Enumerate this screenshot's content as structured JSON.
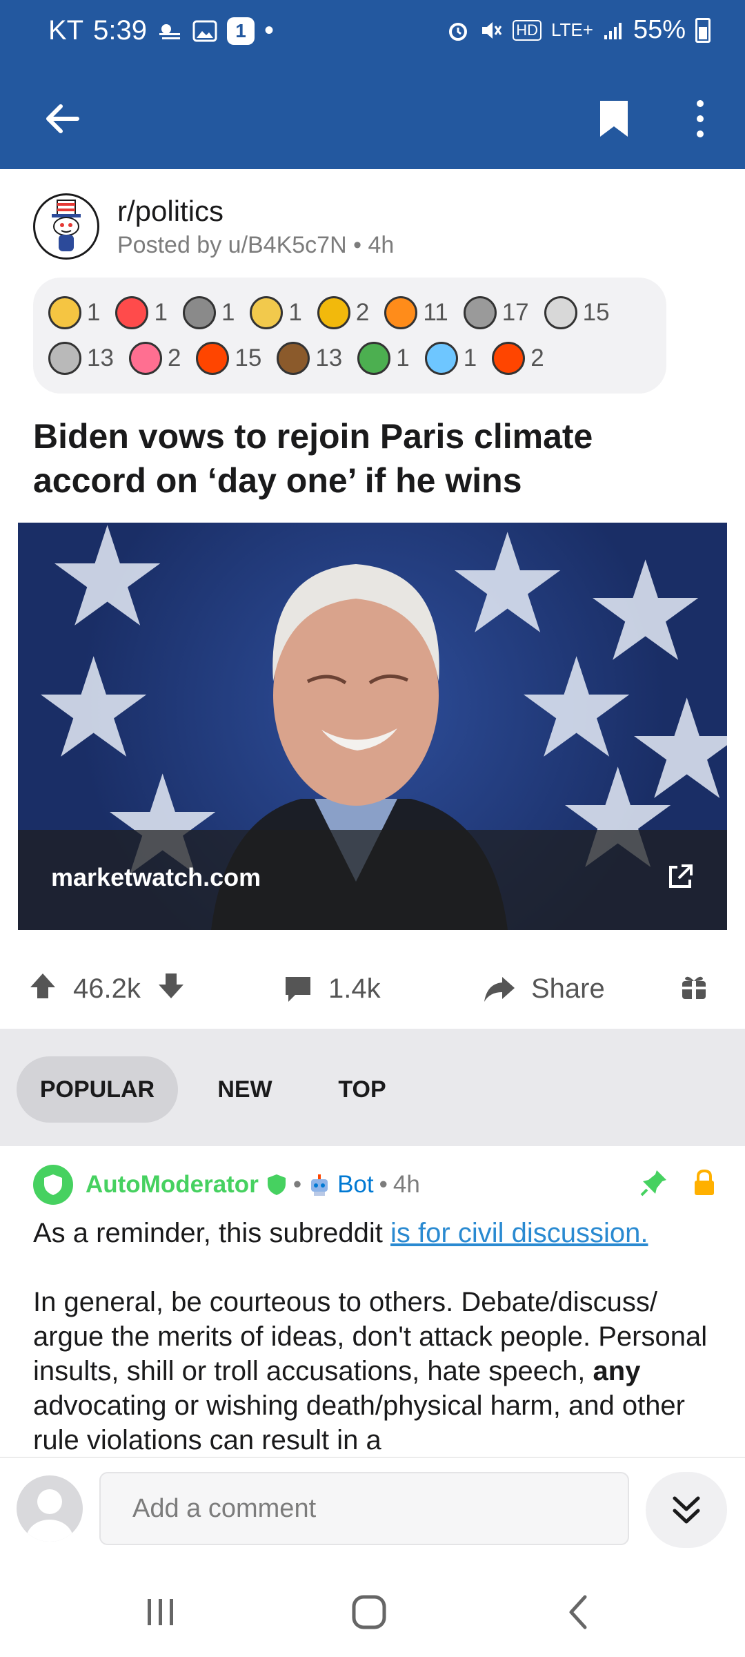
{
  "status_bar": {
    "carrier": "KT",
    "time": "5:39",
    "notification_count": "1",
    "network": "LTE+",
    "battery": "55%"
  },
  "post": {
    "subreddit": "r/politics",
    "posted_by": "Posted by u/B4K5c7N",
    "age": "4h",
    "title": "Biden vows to rejoin Paris climate accord on ‘day one’ if he wins",
    "awards": [
      {
        "icon": "sun-award-icon",
        "count": "1",
        "color": "#f5c542"
      },
      {
        "icon": "heart-eyes-award-icon",
        "count": "1",
        "color": "#ff4b4b"
      },
      {
        "icon": "train-award-icon",
        "count": "1",
        "color": "#8a8a8a"
      },
      {
        "icon": "salute-award-icon",
        "count": "1",
        "color": "#f2c94c"
      },
      {
        "icon": "star-award-icon",
        "count": "2",
        "color": "#f2b90c"
      },
      {
        "icon": "fire-thumbs-up-award-icon",
        "count": "11",
        "color": "#ff8c1a"
      },
      {
        "icon": "handshake-award-icon",
        "count": "17",
        "color": "#9a9a9a"
      },
      {
        "icon": "face-award-icon",
        "count": "15",
        "color": "#d8d8d8"
      },
      {
        "icon": "coin-s-award-icon",
        "count": "13",
        "color": "#b9b9b9"
      },
      {
        "icon": "wholesome-heart-award-icon",
        "count": "2",
        "color": "#ff6f91"
      },
      {
        "icon": "snoo-party-award-icon",
        "count": "15",
        "color": "#ff4500"
      },
      {
        "icon": "bear-award-icon",
        "count": "13",
        "color": "#8b5a2b"
      },
      {
        "icon": "tree-award-icon",
        "count": "1",
        "color": "#4caf50"
      },
      {
        "icon": "angel-award-icon",
        "count": "1",
        "color": "#6ec6ff"
      },
      {
        "icon": "snoo-helpful-award-icon",
        "count": "2",
        "color": "#ff4500"
      }
    ],
    "preview_domain": "marketwatch.com",
    "upvotes": "46.2k",
    "comments": "1.4k",
    "share_label": "Share"
  },
  "sort_tabs": [
    "POPULAR",
    "NEW",
    "TOP"
  ],
  "comment": {
    "author": "AutoModerator",
    "bot_label": "Bot",
    "age": "4h",
    "line1_prefix": "As a reminder, this subreddit ",
    "line1_link": "is for civil discussion.",
    "para2_a": "In general, be courteous to others. Debate/discuss/ argue the merits of ideas, don't attack people. Personal insults, shill or troll accusations, hate speech, ",
    "para2_bold": "any",
    "para2_b": " advocating or wishing death/physical harm, and other rule violations can result in a"
  },
  "composer": {
    "placeholder": "Add a comment"
  },
  "colors": {
    "brand_blue": "#23589f",
    "mod_green": "#46d160",
    "link_blue": "#2a8ad1",
    "lock_yellow": "#ffb000"
  }
}
